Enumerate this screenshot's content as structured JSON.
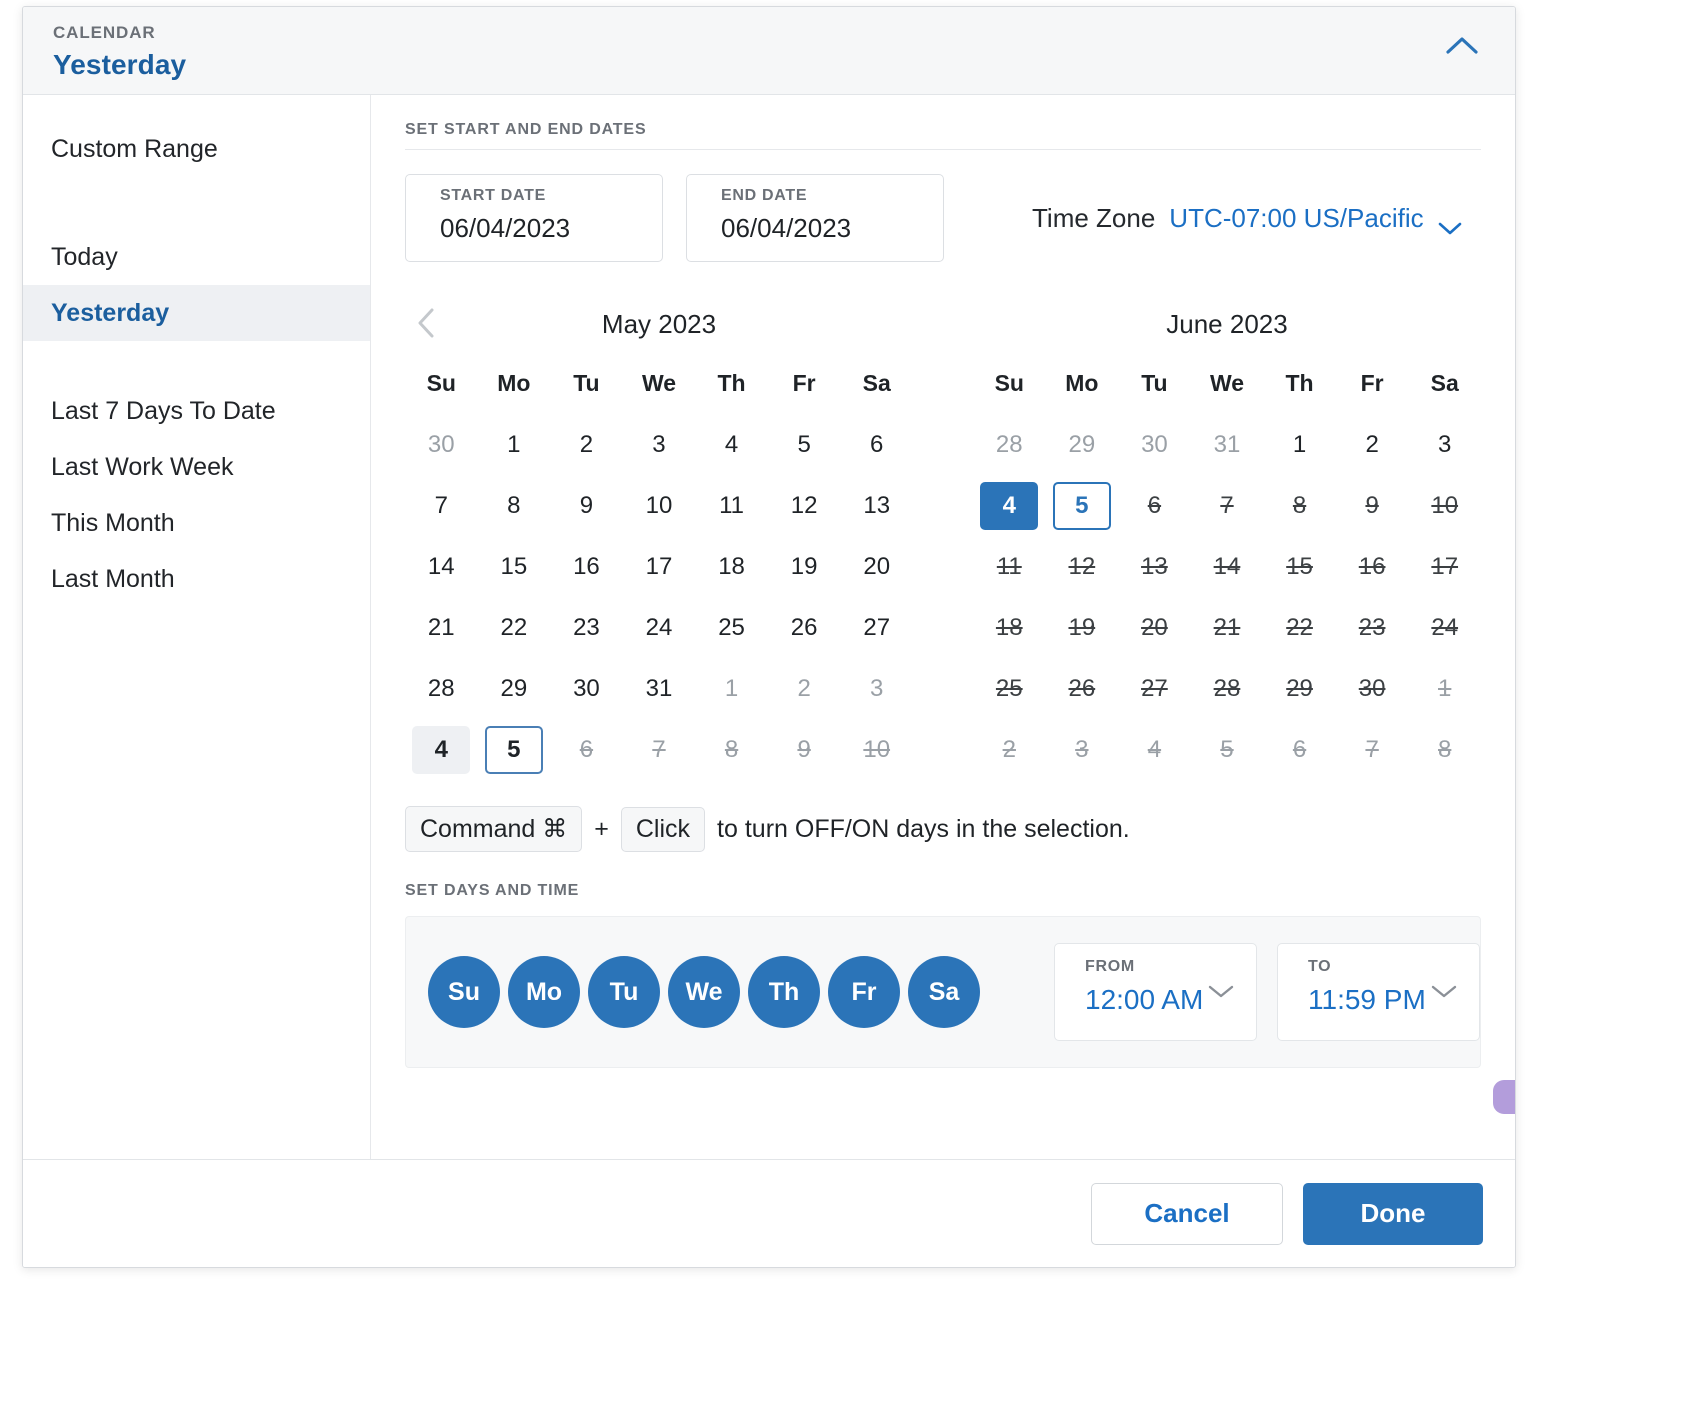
{
  "header": {
    "eyebrow": "CALENDAR",
    "title": "Yesterday",
    "collapse_icon": "chevron-up-icon"
  },
  "sidebar": {
    "items": [
      {
        "label": "Custom Range",
        "active": false
      },
      {
        "label": "Today",
        "active": false
      },
      {
        "label": "Yesterday",
        "active": true
      },
      {
        "label": "Last 7 Days To Date",
        "active": false
      },
      {
        "label": "Last Work Week",
        "active": false
      },
      {
        "label": "This Month",
        "active": false
      },
      {
        "label": "Last Month",
        "active": false
      }
    ]
  },
  "dates_section": {
    "label": "SET START AND END DATES",
    "start": {
      "label": "START DATE",
      "value": "06/04/2023"
    },
    "end": {
      "label": "END DATE",
      "value": "06/04/2023"
    },
    "timezone": {
      "label": "Time Zone",
      "value": "UTC-07:00 US/Pacific",
      "caret_icon": "chevron-down-icon"
    }
  },
  "calendars": {
    "prev_icon": "chevron-left-icon",
    "dow": [
      "Su",
      "Mo",
      "Tu",
      "We",
      "Th",
      "Fr",
      "Sa"
    ],
    "left": {
      "title": "May 2023",
      "weeks": [
        [
          {
            "d": "30",
            "state": "muted"
          },
          {
            "d": "1",
            "state": "normal"
          },
          {
            "d": "2",
            "state": "normal"
          },
          {
            "d": "3",
            "state": "normal"
          },
          {
            "d": "4",
            "state": "normal"
          },
          {
            "d": "5",
            "state": "normal"
          },
          {
            "d": "6",
            "state": "normal"
          }
        ],
        [
          {
            "d": "7",
            "state": "normal"
          },
          {
            "d": "8",
            "state": "normal"
          },
          {
            "d": "9",
            "state": "normal"
          },
          {
            "d": "10",
            "state": "normal"
          },
          {
            "d": "11",
            "state": "normal"
          },
          {
            "d": "12",
            "state": "normal"
          },
          {
            "d": "13",
            "state": "normal"
          }
        ],
        [
          {
            "d": "14",
            "state": "normal"
          },
          {
            "d": "15",
            "state": "normal"
          },
          {
            "d": "16",
            "state": "normal"
          },
          {
            "d": "17",
            "state": "normal"
          },
          {
            "d": "18",
            "state": "normal"
          },
          {
            "d": "19",
            "state": "normal"
          },
          {
            "d": "20",
            "state": "normal"
          }
        ],
        [
          {
            "d": "21",
            "state": "normal"
          },
          {
            "d": "22",
            "state": "normal"
          },
          {
            "d": "23",
            "state": "normal"
          },
          {
            "d": "24",
            "state": "normal"
          },
          {
            "d": "25",
            "state": "normal"
          },
          {
            "d": "26",
            "state": "normal"
          },
          {
            "d": "27",
            "state": "normal"
          }
        ],
        [
          {
            "d": "28",
            "state": "normal"
          },
          {
            "d": "29",
            "state": "normal"
          },
          {
            "d": "30",
            "state": "normal"
          },
          {
            "d": "31",
            "state": "normal"
          },
          {
            "d": "1",
            "state": "muted"
          },
          {
            "d": "2",
            "state": "muted"
          },
          {
            "d": "3",
            "state": "muted"
          }
        ],
        [
          {
            "d": "4",
            "state": "shadow-fill"
          },
          {
            "d": "5",
            "state": "shadow-outline"
          },
          {
            "d": "6",
            "state": "off-muted"
          },
          {
            "d": "7",
            "state": "off-muted"
          },
          {
            "d": "8",
            "state": "off-muted"
          },
          {
            "d": "9",
            "state": "off-muted"
          },
          {
            "d": "10",
            "state": "off-muted"
          }
        ]
      ]
    },
    "right": {
      "title": "June 2023",
      "weeks": [
        [
          {
            "d": "28",
            "state": "muted"
          },
          {
            "d": "29",
            "state": "muted"
          },
          {
            "d": "30",
            "state": "muted"
          },
          {
            "d": "31",
            "state": "muted"
          },
          {
            "d": "1",
            "state": "normal"
          },
          {
            "d": "2",
            "state": "normal"
          },
          {
            "d": "3",
            "state": "normal"
          }
        ],
        [
          {
            "d": "4",
            "state": "sel-fill"
          },
          {
            "d": "5",
            "state": "sel-outline"
          },
          {
            "d": "6",
            "state": "off"
          },
          {
            "d": "7",
            "state": "off"
          },
          {
            "d": "8",
            "state": "off"
          },
          {
            "d": "9",
            "state": "off"
          },
          {
            "d": "10",
            "state": "off"
          }
        ],
        [
          {
            "d": "11",
            "state": "off"
          },
          {
            "d": "12",
            "state": "off"
          },
          {
            "d": "13",
            "state": "off"
          },
          {
            "d": "14",
            "state": "off"
          },
          {
            "d": "15",
            "state": "off"
          },
          {
            "d": "16",
            "state": "off"
          },
          {
            "d": "17",
            "state": "off"
          }
        ],
        [
          {
            "d": "18",
            "state": "off"
          },
          {
            "d": "19",
            "state": "off"
          },
          {
            "d": "20",
            "state": "off"
          },
          {
            "d": "21",
            "state": "off"
          },
          {
            "d": "22",
            "state": "off"
          },
          {
            "d": "23",
            "state": "off"
          },
          {
            "d": "24",
            "state": "off"
          }
        ],
        [
          {
            "d": "25",
            "state": "off"
          },
          {
            "d": "26",
            "state": "off"
          },
          {
            "d": "27",
            "state": "off"
          },
          {
            "d": "28",
            "state": "off"
          },
          {
            "d": "29",
            "state": "off"
          },
          {
            "d": "30",
            "state": "off"
          },
          {
            "d": "1",
            "state": "off-muted"
          }
        ],
        [
          {
            "d": "2",
            "state": "off-muted"
          },
          {
            "d": "3",
            "state": "off-muted"
          },
          {
            "d": "4",
            "state": "off-muted"
          },
          {
            "d": "5",
            "state": "off-muted"
          },
          {
            "d": "6",
            "state": "off-muted"
          },
          {
            "d": "7",
            "state": "off-muted"
          },
          {
            "d": "8",
            "state": "off-muted"
          }
        ]
      ]
    }
  },
  "hint": {
    "key_command": "Command ⌘",
    "plus": "+",
    "key_click": "Click",
    "tail": "to turn OFF/ON days in the selection."
  },
  "days_time": {
    "label": "SET DAYS AND TIME",
    "day_circles": [
      "Su",
      "Mo",
      "Tu",
      "We",
      "Th",
      "Fr",
      "Sa"
    ],
    "from": {
      "label": "FROM",
      "value": "12:00 AM",
      "caret_icon": "chevron-down-icon"
    },
    "to": {
      "label": "TO",
      "value": "11:59 PM",
      "caret_icon": "chevron-down-icon"
    }
  },
  "footer": {
    "cancel_label": "Cancel",
    "done_label": "Done"
  },
  "colors": {
    "accent": "#2b74b8",
    "link": "#1b6fc4",
    "title": "#1b5e9e",
    "muted": "#9aa0a6"
  }
}
